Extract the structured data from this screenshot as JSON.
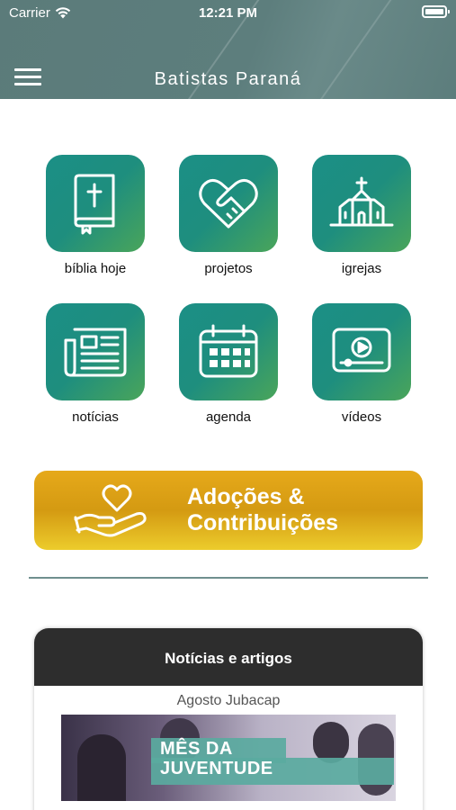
{
  "status_bar": {
    "carrier": "Carrier",
    "time": "12:21 PM",
    "wifi_icon": "wifi-icon",
    "battery_icon": "battery-icon"
  },
  "header": {
    "title": "Batistas Paraná",
    "menu_icon": "hamburger-menu-icon",
    "background": "#5c7d7c"
  },
  "tiles": [
    {
      "label": "bíblia hoje",
      "icon": "bible-icon"
    },
    {
      "label": "projetos",
      "icon": "heart-handshake-icon"
    },
    {
      "label": "igrejas",
      "icon": "church-icon"
    },
    {
      "label": "notícias",
      "icon": "newspaper-icon"
    },
    {
      "label": "agenda",
      "icon": "calendar-icon"
    },
    {
      "label": "vídeos",
      "icon": "video-player-icon"
    }
  ],
  "donate": {
    "line1": "Adoções &",
    "line2": "Contribuições",
    "icon": "hand-heart-icon",
    "color": "#e0a516"
  },
  "news": {
    "header": "Notícias e artigos",
    "article_title": "Agosto Jubacap",
    "image_text_line1": "MÊS DA",
    "image_text_line2": "JUVENTUDE"
  },
  "colors": {
    "tile_gradient_start": "#1b8f86",
    "tile_gradient_end": "#4aa55a",
    "news_header": "#2d2d2d"
  }
}
